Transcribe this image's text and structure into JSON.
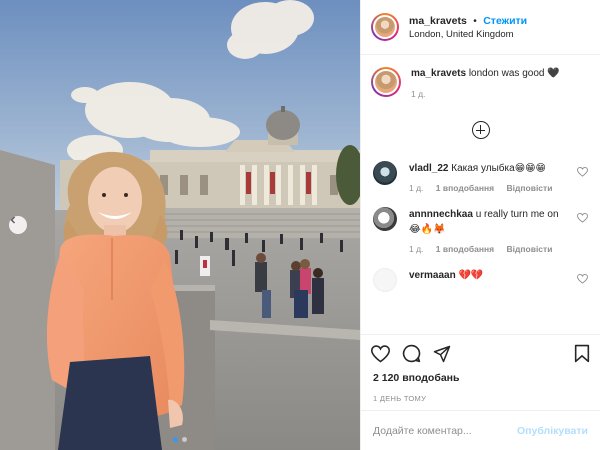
{
  "post": {
    "username": "ma_kravets",
    "follow_label": "Стежити",
    "separator": "•",
    "location": "London, United Kingdom",
    "caption": {
      "username": "ma_kravets",
      "text": "london was good 🖤",
      "time": "1 д."
    },
    "comments": [
      {
        "username": "vladl_22",
        "text": "Какая улыбка😁😁😁",
        "time": "1 д.",
        "likes": "1 вподобання",
        "reply": "Відповісти",
        "avatar_color": "#3a4a52"
      },
      {
        "username": "annnnechkaa",
        "text": "u really turn me on 😂🔥🦊",
        "time": "1 д.",
        "likes": "1 вподобання",
        "reply": "Відповісти",
        "avatar_color": "#5a5a5a"
      },
      {
        "username": "vermaaan",
        "text": "💔💔",
        "time": "",
        "likes": "",
        "reply": "",
        "avatar_color": "#f2f2f2"
      }
    ],
    "likes_count": "2 120 вподобань",
    "timestamp": "1 ДЕНЬ ТОМУ",
    "comment_placeholder": "Додайте коментар...",
    "publish_label": "Опублікувати",
    "carousel": {
      "total": 2,
      "active": 1
    }
  },
  "colors": {
    "link": "#0095f6",
    "muted": "#8e8e8e",
    "text": "#262626",
    "publish_disabled": "#b2dffc"
  },
  "icons": [
    "chevron-left-icon",
    "heart-icon",
    "comment-icon",
    "share-icon",
    "bookmark-icon",
    "add-comments-icon"
  ]
}
